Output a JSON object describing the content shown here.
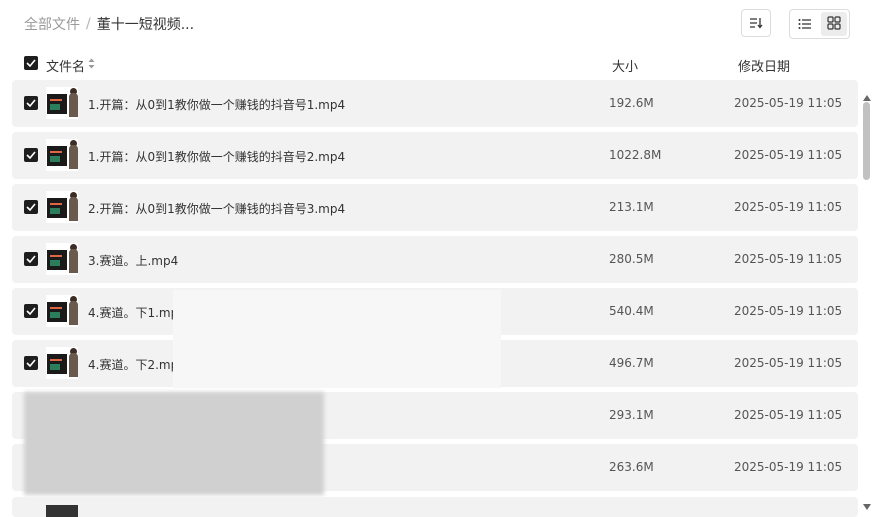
{
  "breadcrumb": {
    "root": "全部文件",
    "separator": "/",
    "current": "董十一短视频..."
  },
  "toolbar": {
    "sort_icon": "sort-icon",
    "list_view_icon": "list-view-icon",
    "grid_view_icon": "grid-view-icon",
    "active_view": "grid"
  },
  "columns": {
    "name": "文件名",
    "size": "大小",
    "modified": "修改日期"
  },
  "files": [
    {
      "name": "1.开篇：从0到1教你做一个赚钱的抖音号1.mp4",
      "size": "192.6M",
      "modified": "2025-05-19 11:05",
      "checked": true
    },
    {
      "name": "1.开篇：从0到1教你做一个赚钱的抖音号2.mp4",
      "size": "1022.8M",
      "modified": "2025-05-19 11:05",
      "checked": true
    },
    {
      "name": "2.开篇：从0到1教你做一个赚钱的抖音号3.mp4",
      "size": "213.1M",
      "modified": "2025-05-19 11:05",
      "checked": true
    },
    {
      "name": "3.赛道。上.mp4",
      "size": "280.5M",
      "modified": "2025-05-19 11:05",
      "checked": true
    },
    {
      "name": "4.赛道。下1.mp",
      "size": "540.4M",
      "modified": "2025-05-19 11:05",
      "checked": true
    },
    {
      "name": "4.赛道。下2.mp",
      "size": "496.7M",
      "modified": "2025-05-19 11:05",
      "checked": true
    },
    {
      "name": "",
      "size": "293.1M",
      "modified": "2025-05-19 11:05",
      "checked": true
    },
    {
      "name": "",
      "size": "263.6M",
      "modified": "2025-05-19 11:05",
      "checked": true
    }
  ]
}
